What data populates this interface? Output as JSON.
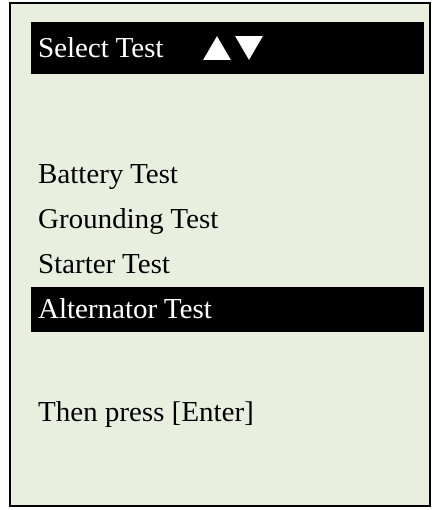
{
  "header": {
    "title": "Select Test",
    "up_icon": "triangle-up-icon",
    "down_icon": "triangle-down-icon"
  },
  "menu": {
    "items": [
      {
        "label": "Battery Test",
        "selected": false
      },
      {
        "label": "Grounding Test",
        "selected": false
      },
      {
        "label": "Starter Test",
        "selected": false
      },
      {
        "label": "Alternator Test",
        "selected": true
      }
    ]
  },
  "footer": {
    "hint": "Then press [Enter]"
  },
  "colors": {
    "screen_background": "#e9efdf",
    "highlight_background": "#000000",
    "highlight_text": "#ffffff",
    "text": "#000000"
  }
}
